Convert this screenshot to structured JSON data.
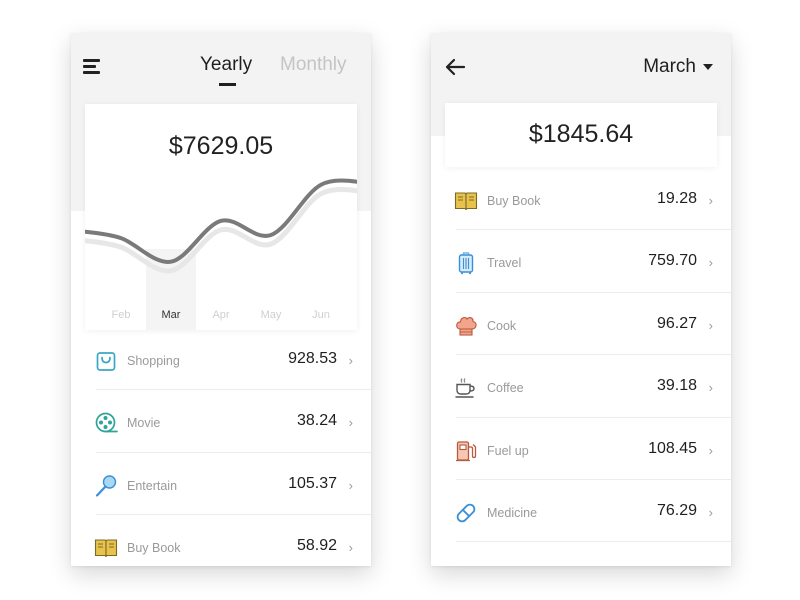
{
  "left_screen": {
    "tabs": [
      {
        "label": "Yearly",
        "active": true
      },
      {
        "label": "Monthly",
        "active": false
      }
    ],
    "total": "$7629.05",
    "chart_data": {
      "type": "line",
      "title": "",
      "categories": [
        "Feb",
        "Mar",
        "Apr",
        "May",
        "Jun"
      ],
      "selected_category": "Mar",
      "series": [
        {
          "values": [
            2.6,
            1.1,
            3.7,
            2.8,
            6.0
          ],
          "color": "#7a7a7a"
        }
      ],
      "ylim": [
        0,
        7
      ],
      "grid": false
    },
    "items": [
      {
        "icon": "shopping-bag-icon",
        "label": "Shopping",
        "value": "928.53"
      },
      {
        "icon": "film-reel-icon",
        "label": "Movie",
        "value": "38.24"
      },
      {
        "icon": "microphone-icon",
        "label": "Entertain",
        "value": "105.37"
      },
      {
        "icon": "book-icon",
        "label": "Buy Book",
        "value": "58.92"
      }
    ]
  },
  "right_screen": {
    "month": "March",
    "total": "$1845.64",
    "items": [
      {
        "icon": "book-icon",
        "label": "Buy Book",
        "value": "19.28"
      },
      {
        "icon": "suitcase-icon",
        "label": "Travel",
        "value": "759.70"
      },
      {
        "icon": "chef-hat-icon",
        "label": "Cook",
        "value": "96.27"
      },
      {
        "icon": "coffee-cup-icon",
        "label": "Coffee",
        "value": "39.18"
      },
      {
        "icon": "fuel-pump-icon",
        "label": "Fuel up",
        "value": "108.45"
      },
      {
        "icon": "pill-icon",
        "label": "Medicine",
        "value": "76.29"
      },
      {
        "icon": "gift-icon",
        "label": "",
        "value": ""
      }
    ]
  },
  "colors": {
    "header_bg": "#f3f3f3",
    "text_primary": "#1f1f1f",
    "text_muted": "#9a9a9a",
    "tab_inactive": "#c4c4c4",
    "line": "#7a7a7a",
    "book": "#e8c24a",
    "travel": "#6fb6e8",
    "cook": "#e8846a",
    "medicine": "#3a8fd6",
    "movie": "#2ea39a",
    "shopping": "#3aa7c4"
  },
  "chevron": "›"
}
